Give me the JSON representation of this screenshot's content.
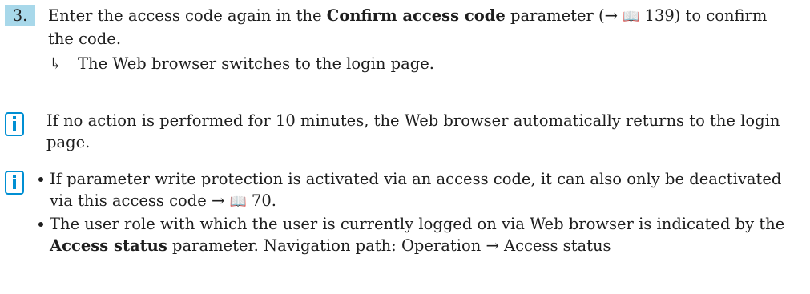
{
  "step": {
    "number": "3.",
    "text_before": "Enter the access code again in the ",
    "param_name": "Confirm access code",
    "text_middle": " parameter (→ ",
    "book_icon": "📖",
    "page_ref": " 139",
    "text_after": ") to confirm the code."
  },
  "result": {
    "arrow": "↳",
    "text": "The Web browser switches to the login page."
  },
  "note1": {
    "icon": "info-icon",
    "text": "If no action is performed for 10 minutes, the Web browser automatically returns to the login page."
  },
  "note2": {
    "icon": "info-icon",
    "bullet1": {
      "text": "If parameter write protection is activated via an access code, it can also only be deactivated via this access code →  ",
      "book_icon": "📖",
      "page_ref": " 70."
    },
    "bullet2": {
      "text_before": "The user role with which the user is currently logged on via Web browser is indicated by the ",
      "param_name": "Access status",
      "text_after": " parameter. Navigation path: Operation → Access status"
    }
  }
}
